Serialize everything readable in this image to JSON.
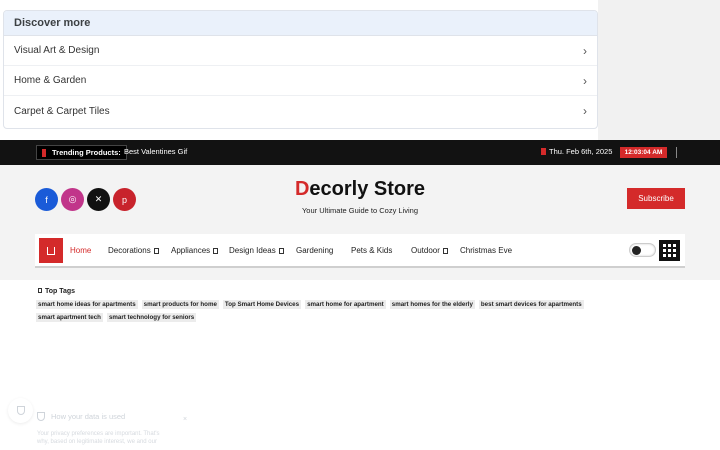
{
  "discover": {
    "title": "Discover more",
    "items": [
      "Visual Art & Design",
      "Home & Garden",
      "Carpet & Carpet Tiles"
    ]
  },
  "topbar": {
    "trending_label": "Trending Products:",
    "trending_text": "Best Valentines Gif",
    "date": "Thu. Feb 6th, 2025",
    "time": "12:03:04 AM"
  },
  "header": {
    "logo_first": "D",
    "logo_rest": "ecorly Store",
    "tagline": "Your Ultimate Guide to Cozy Living",
    "subscribe": "Subscribe",
    "social_icons": [
      "facebook-icon",
      "instagram-icon",
      "x-icon",
      "pinterest-icon"
    ],
    "social_colors": [
      "#1a5bd8",
      "#c1358a",
      "#111111",
      "#c8232c"
    ]
  },
  "nav": {
    "items": [
      "Home",
      "Decorations",
      "Appliances",
      "Design Ideas",
      "Gardening",
      "Pets & Kids",
      "Outdoor",
      "Christmas Eve"
    ]
  },
  "tags": {
    "title": "Top Tags",
    "items": [
      "smart home ideas for apartments",
      "smart products for home",
      "Top Smart Home Devices",
      "smart home for apartment",
      "smart homes for the elderly",
      "best smart devices for apartments",
      "smart apartment tech",
      "smart technology for seniors"
    ]
  },
  "consent": {
    "title": "How your data is used",
    "close": "×",
    "text": "Your privacy preferences are important. That's why, based on legitimate interest, we and our"
  },
  "colors": {
    "accent": "#d42a2a",
    "topbar": "#121212",
    "header_bg": "#f3f3f3"
  }
}
